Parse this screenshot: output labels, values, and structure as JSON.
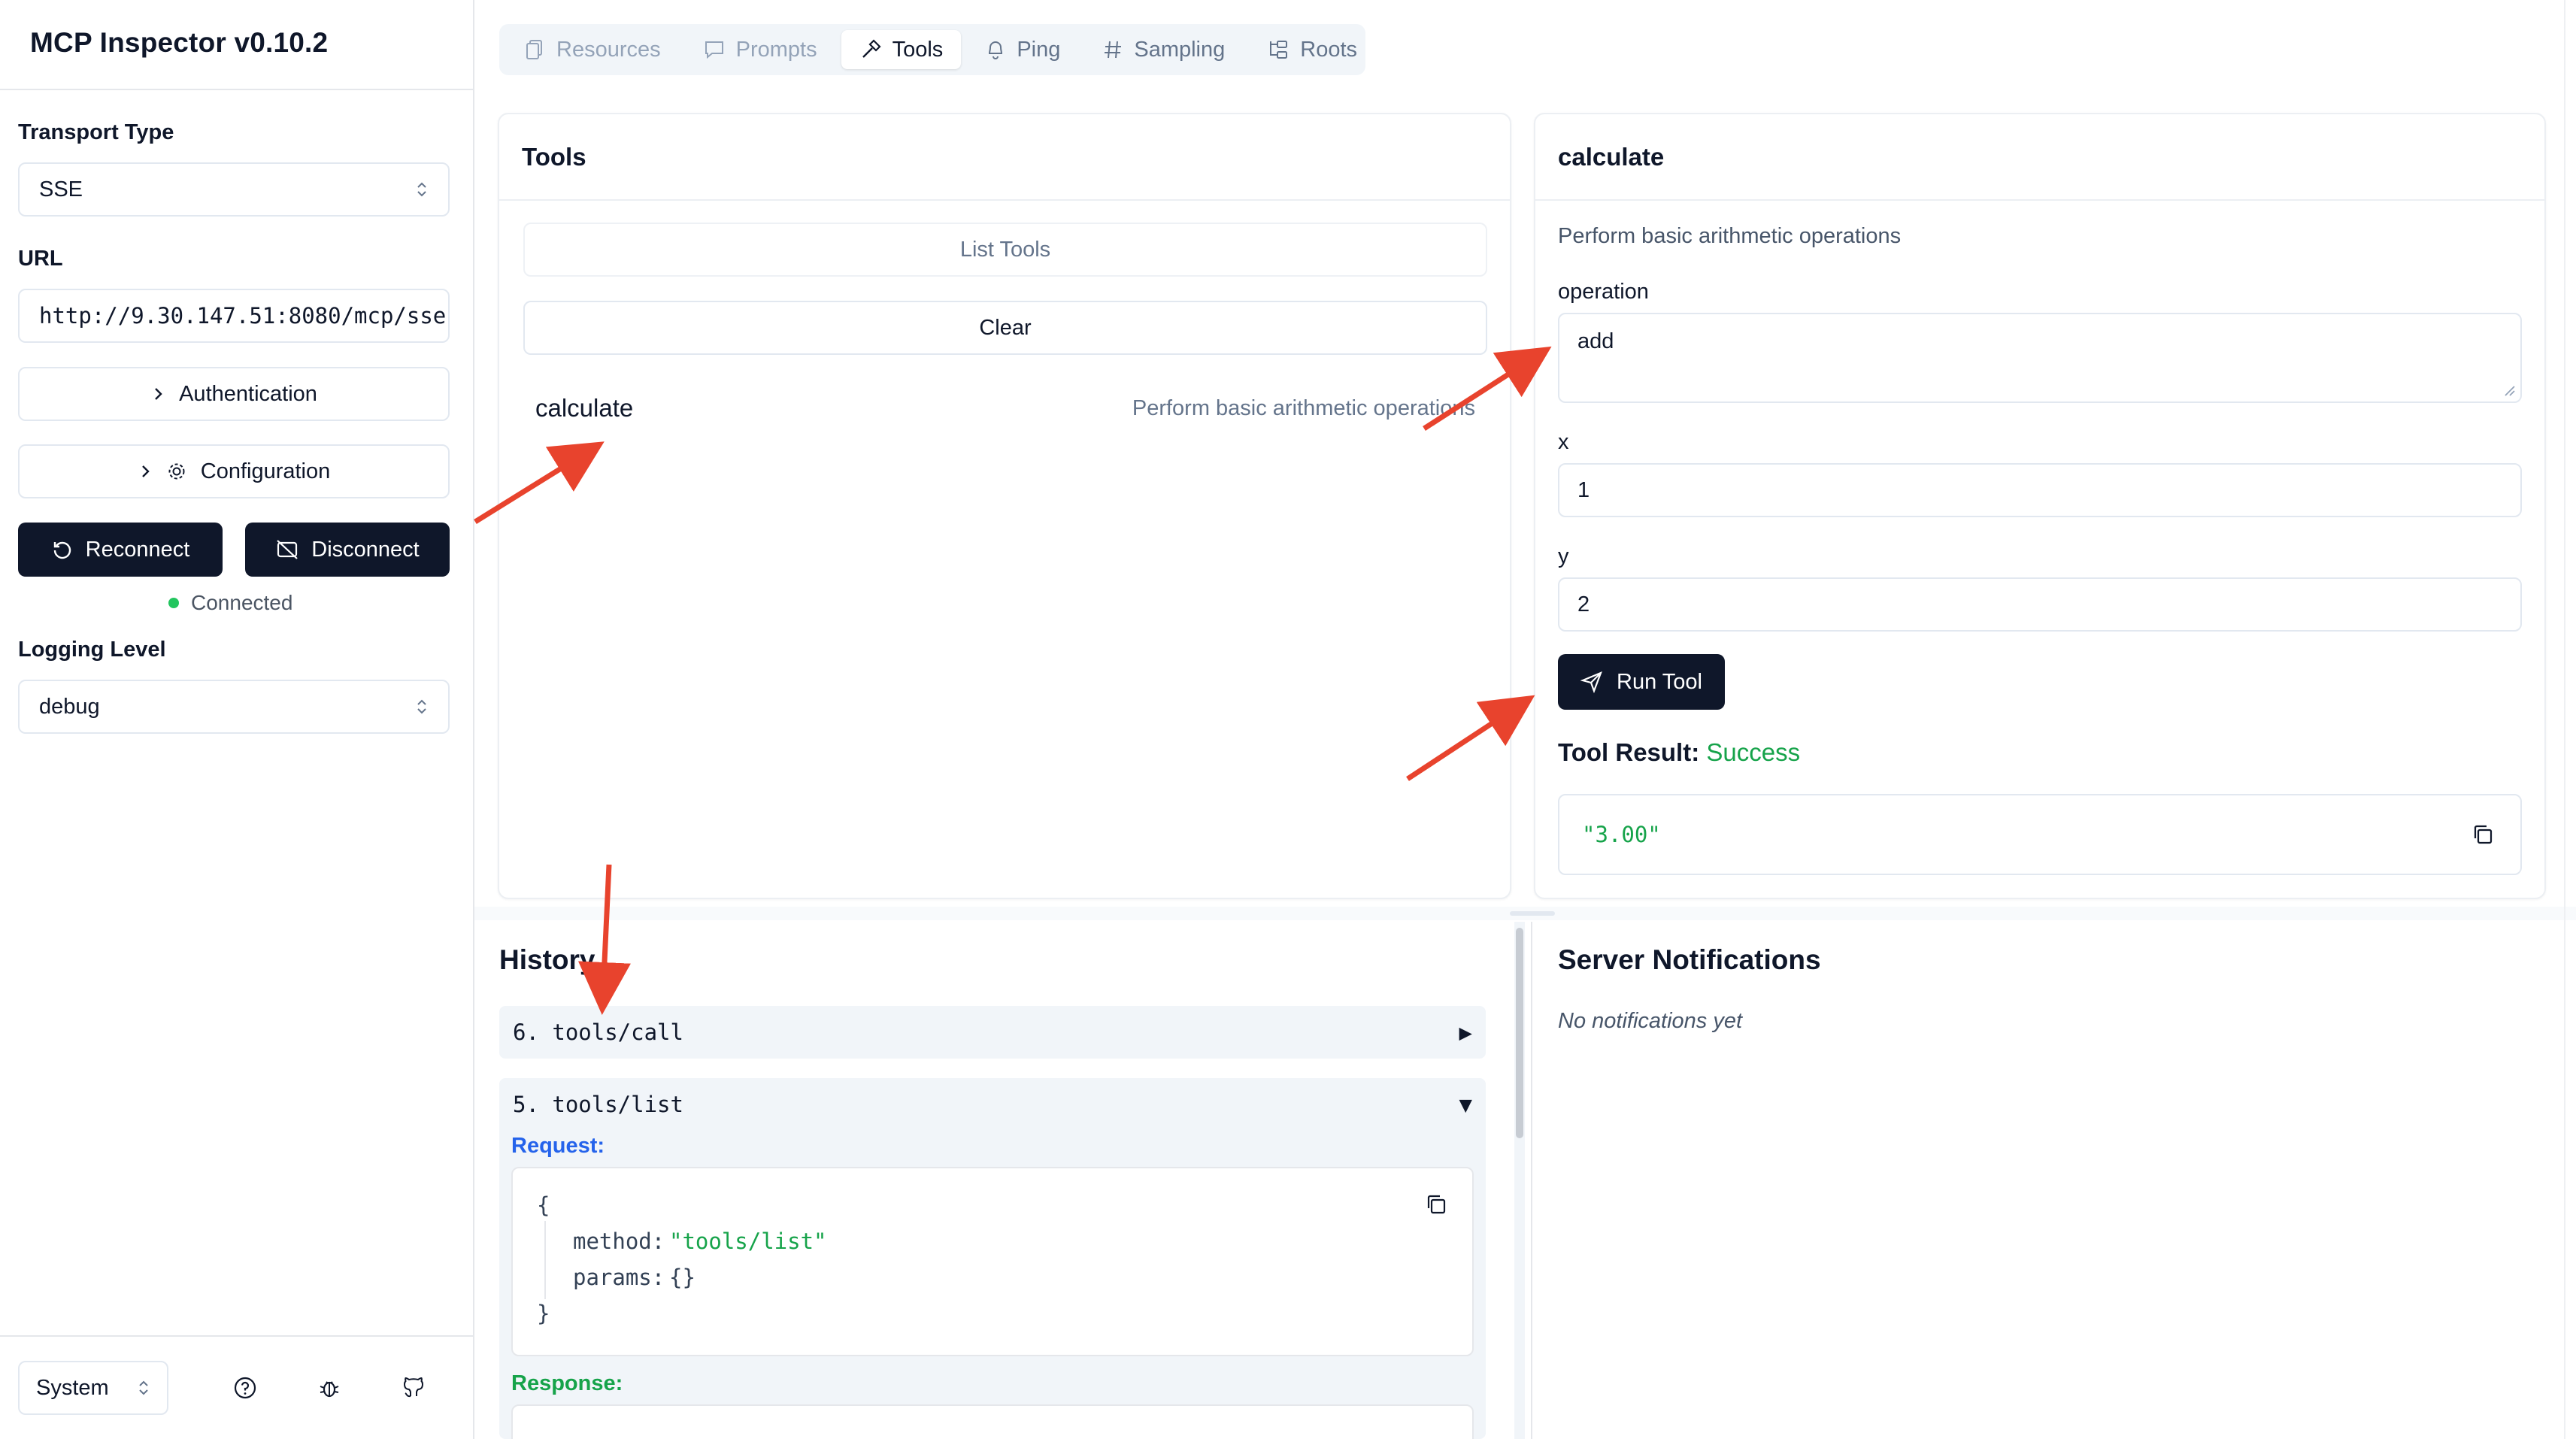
{
  "app": {
    "title": "MCP Inspector v0.10.2"
  },
  "sidebar": {
    "transport_label": "Transport Type",
    "transport_value": "SSE",
    "url_label": "URL",
    "url_value": "http://9.30.147.51:8080/mcp/sse",
    "authentication": "Authentication",
    "configuration": "Configuration",
    "reconnect": "Reconnect",
    "disconnect": "Disconnect",
    "status": "Connected",
    "logging_label": "Logging Level",
    "logging_value": "debug",
    "theme_value": "System"
  },
  "tabs": [
    {
      "label": "Resources",
      "icon": "file-icon",
      "state": "disabled"
    },
    {
      "label": "Prompts",
      "icon": "message-icon",
      "state": "disabled"
    },
    {
      "label": "Tools",
      "icon": "hammer-icon",
      "state": "active"
    },
    {
      "label": "Ping",
      "icon": "bell-icon",
      "state": "normal"
    },
    {
      "label": "Sampling",
      "icon": "hash-icon",
      "state": "normal"
    },
    {
      "label": "Roots",
      "icon": "folder-tree-icon",
      "state": "normal"
    }
  ],
  "tools_panel": {
    "title": "Tools",
    "list_tools": "List Tools",
    "clear": "Clear",
    "tool_name": "calculate",
    "tool_description": "Perform basic arithmetic operations"
  },
  "detail_panel": {
    "title": "calculate",
    "description": "Perform basic arithmetic operations",
    "operation_label": "operation",
    "operation_value": "add",
    "x_label": "x",
    "x_value": "1",
    "y_label": "y",
    "y_value": "2",
    "run_tool": "Run Tool",
    "result_label": "Tool Result:",
    "result_status": "Success",
    "result_value": "\"3.00\""
  },
  "history": {
    "title": "History",
    "items": [
      {
        "label": "6. tools/call",
        "toggle": "▶"
      },
      {
        "label": "5. tools/list",
        "toggle": "▼"
      }
    ],
    "request_label": "Request:",
    "response_label": "Response:",
    "code": {
      "open": "{",
      "method_key": "method:",
      "method_value": "\"tools/list\"",
      "params_key": "params:",
      "params_value": "{}",
      "close": "}"
    }
  },
  "notifications": {
    "title": "Server Notifications",
    "empty": "No notifications yet"
  },
  "colors": {
    "dark": "#0f172a",
    "success": "#16a34a",
    "request": "#2563eb",
    "response": "#16a34a",
    "annotation_arrow": "#e8432d"
  }
}
